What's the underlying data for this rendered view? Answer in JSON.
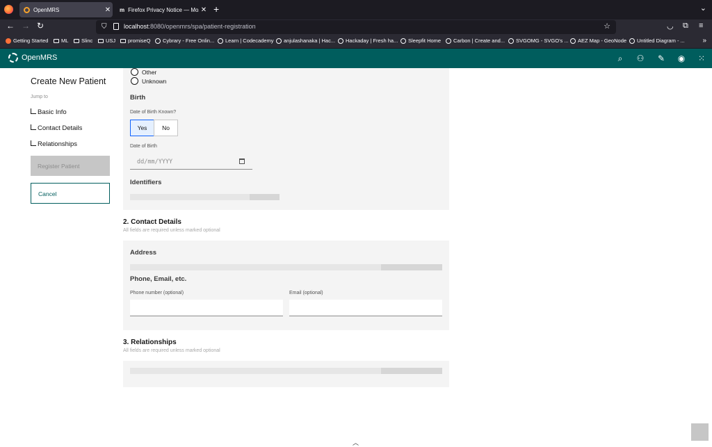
{
  "browser": {
    "tabs": [
      {
        "title": "OpenMRS",
        "active": true
      },
      {
        "title": "Firefox Privacy Notice — Mozilla",
        "active": false
      }
    ],
    "url_host": "localhost",
    "url_rest": ":8080/openmrs/spa/patient-registration",
    "bookmarks": [
      {
        "label": "Getting Started",
        "icon": "firefox-icon"
      },
      {
        "label": "ML",
        "icon": "folder-icon"
      },
      {
        "label": "Slinc",
        "icon": "folder-icon"
      },
      {
        "label": "USJ",
        "icon": "folder-icon"
      },
      {
        "label": "promiseQ",
        "icon": "folder-icon"
      },
      {
        "label": "Cybrary - Free Onlin...",
        "icon": "globe-icon"
      },
      {
        "label": "Learn | Codecademy",
        "icon": "globe-icon"
      },
      {
        "label": "anjulashanaka | Hac...",
        "icon": "globe-icon"
      },
      {
        "label": "Hackaday | Fresh ha...",
        "icon": "globe-icon"
      },
      {
        "label": "Sleepfit Home",
        "icon": "globe-icon"
      },
      {
        "label": "Carbon | Create and...",
        "icon": "globe-icon"
      },
      {
        "label": "SVGOMG - SVGO's ...",
        "icon": "globe-icon"
      },
      {
        "label": "AEZ Map - GeoNode",
        "icon": "globe-icon"
      },
      {
        "label": "Untitled Diagram - ...",
        "icon": "globe-icon"
      }
    ]
  },
  "app": {
    "brand": "OpenMRS",
    "accent_color": "#005d5d"
  },
  "sidebar": {
    "title": "Create New Patient",
    "jump_to": "Jump to",
    "links": [
      "Basic Info",
      "Contact Details",
      "Relationships"
    ],
    "register_label": "Register Patient",
    "cancel_label": "Cancel"
  },
  "basic_info": {
    "gender_options": [
      "Other",
      "Unknown"
    ],
    "birth_heading": "Birth",
    "dob_known_label": "Date of Birth Known?",
    "yes_label": "Yes",
    "no_label": "No",
    "dob_label": "Date of Birth",
    "dob_placeholder": "dd/mm/YYYY",
    "identifiers_heading": "Identifiers"
  },
  "contact_details": {
    "title": "2. Contact Details",
    "subtitle": "All fields are required unless marked optional",
    "address_heading": "Address",
    "phone_email_heading": "Phone, Email, etc.",
    "phone_label": "Phone number (optional)",
    "email_label": "Email (optional)"
  },
  "relationships": {
    "title": "3. Relationships",
    "subtitle": "All fields are required unless marked optional"
  }
}
